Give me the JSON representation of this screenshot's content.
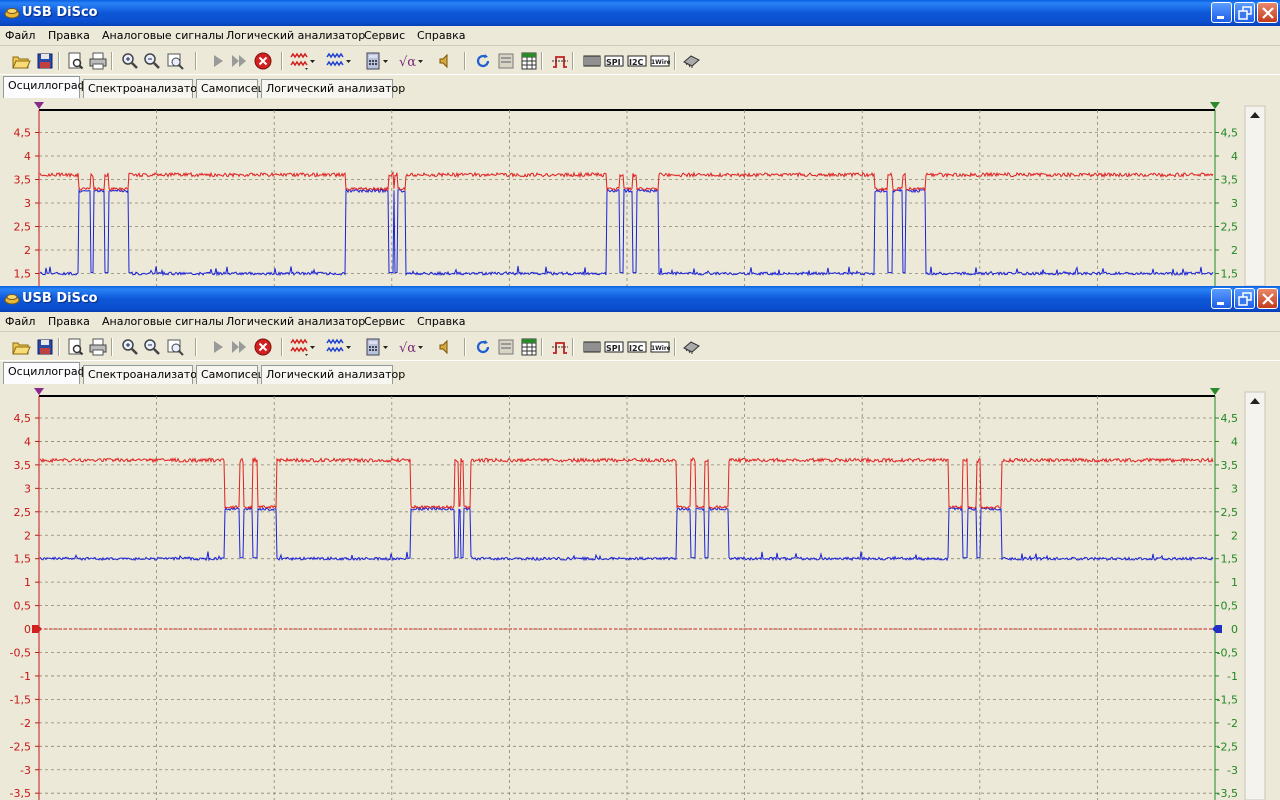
{
  "app": {
    "title": "USB DiSco"
  },
  "menu": [
    "Файл",
    "Правка",
    "Аналоговые сигналы",
    "Логический анализатор",
    "Сервис",
    "Справка"
  ],
  "tabs": [
    "Осциллограф",
    "Спектроанализатор",
    "Самописец",
    "Логический анализатор"
  ],
  "toolbar_icons": [
    "open-icon",
    "save-icon",
    "print-preview-icon",
    "print-icon",
    "zoom-in-icon",
    "zoom-out-icon",
    "zoom-fit-icon",
    "run-icon",
    "run-continuous-icon",
    "stop-icon",
    "channel-a-icon",
    "channel-b-icon",
    "calculator-icon",
    "math-function-icon",
    "sound-icon",
    "refresh-icon",
    "panel-icon",
    "table-icon",
    "trigger-icon",
    "bus-icon",
    "spi-icon",
    "i2c-icon",
    "1wire-icon",
    "chip-icon"
  ],
  "toolbar_labels": {
    "spi": "SPI",
    "i2c": "I2C",
    "onewire": "1Wire"
  },
  "colors": {
    "ch_red": "#e02020",
    "ch_blue": "#1a22d8",
    "grid": "#8a8870",
    "left_axis": "#c81818",
    "right_axis": "#228822"
  },
  "top": {
    "left_ticks": [
      "4,5",
      "4",
      "3,5",
      "3",
      "2,5",
      "2",
      "1,5"
    ],
    "right_ticks": [
      "4,5",
      "4",
      "3,5",
      "3",
      "2,5",
      "2",
      "1,5"
    ],
    "red_level_high": 3.6,
    "blue_level_low": 1.5,
    "overlap_level": 3.3
  },
  "bottom": {
    "left_ticks": [
      "4,5",
      "4",
      "3,5",
      "3",
      "2,5",
      "2",
      "1,5",
      "1",
      "0,5",
      "0",
      "-0,5",
      "-1",
      "-1,5",
      "-2",
      "-2,5",
      "-3",
      "-3,5"
    ],
    "right_ticks": [
      "4,5",
      "4",
      "3,5",
      "3",
      "2,5",
      "2",
      "1,5",
      "1",
      "0,5",
      "0",
      "-0,5",
      "-1",
      "-1,5",
      "-2",
      "-2,5",
      "-3",
      "-3,5"
    ],
    "red_level_high": 3.6,
    "blue_level_low": 1.5,
    "overlap_level": 2.6
  }
}
